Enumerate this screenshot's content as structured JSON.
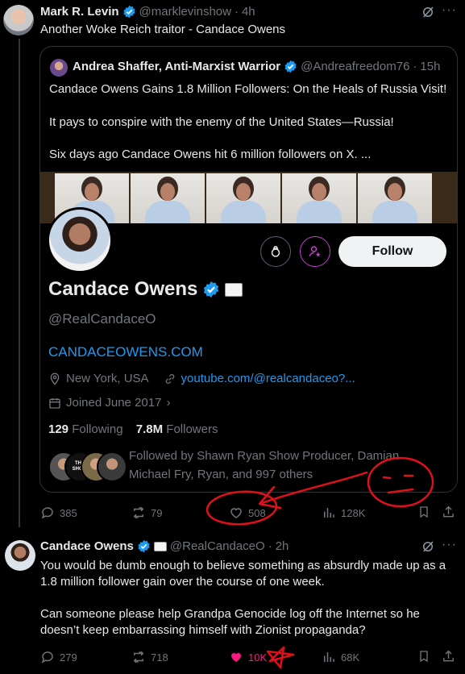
{
  "post1": {
    "author": "Mark R. Levin",
    "handle": "@marklevinshow",
    "time": "4h",
    "text": "Another Woke Reich traitor - Candace Owens",
    "replies": "385",
    "reposts": "79",
    "likes": "508",
    "views": "128K"
  },
  "quote": {
    "author": "Andrea Shaffer, Anti-Marxist Warrior",
    "handle": "@Andreafreedom76",
    "time": "15h",
    "lines": [
      "Candace Owens Gains 1.8 Million Followers: On the Heals of Russia Visit!",
      "It pays to conspire with the enemy of the United States—Russia!",
      "Six days ago Candace Owens hit 6 million followers on X.  ..."
    ]
  },
  "profile": {
    "follow_label": "Follow",
    "name": "Candace Owens",
    "handle": "@RealCandaceO",
    "website": "CANDACEOWENS.COM",
    "location": "New York, USA",
    "link": "youtube.com/@realcandaceo?...",
    "joined": "Joined June 2017",
    "following_count": "129",
    "following_label": "Following",
    "followers_count": "7.8M",
    "followers_label": "Followers",
    "followed_by_1": "Followed by Shawn Ryan Show Producer, Damian",
    "followed_by_2": "Michael Fry, Ryan, and 997 others",
    "mini_badge_text": "THE SHOW"
  },
  "post2": {
    "author": "Candace Owens",
    "handle": "@RealCandaceO",
    "time": "2h",
    "line1": "You would be dumb enough to believe something as absurdly made up as a",
    "line2": "1.8 million follower gain over the course of one week.",
    "line3": "Can someone please help Grandpa Genocide log off the Internet so he",
    "line4": "doesn’t keep embarrassing himself with Zionist propaganda?",
    "replies": "279",
    "reposts": "718",
    "likes": "10K",
    "views": "68K"
  },
  "colors": {
    "background": "#000000",
    "text": "#e7e9ea",
    "muted": "#71767b",
    "link": "#1d9bf0",
    "verified": "#1d9bf0",
    "like_active": "#f91880",
    "annotation": "#e0101a"
  }
}
